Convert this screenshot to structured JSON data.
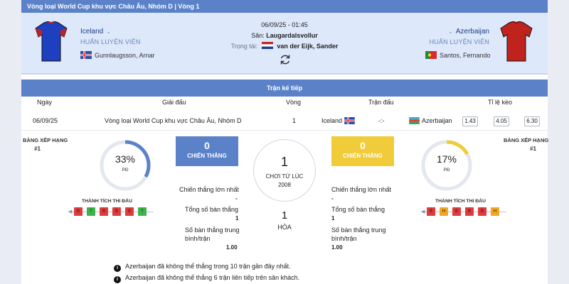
{
  "header": {
    "competition": "Vòng loại World Cup khu vực Châu Âu, Nhóm D | Vòng 1",
    "datetime": "06/09/25 - 01:45",
    "stadium_label": "Sân:",
    "stadium": "Laugardalsvollur",
    "referee_label": "Trọng tài:",
    "referee": "van der Eijk, Sander"
  },
  "home": {
    "name": "Iceland",
    "coach_label": "HUẤN LUYỆN VIÊN",
    "coach": "Gunnlaugsson, Arnar",
    "jersey_color": "#1e3fbf"
  },
  "away": {
    "name": "Azerbaijan",
    "coach_label": "HUẤN LUYỆN VIÊN",
    "coach": "Santos, Fernando",
    "jersey_color": "#c0221e"
  },
  "next_match": {
    "title": "Trận kế tiếp",
    "columns": [
      "Ngày",
      "Giải đấu",
      "Vòng",
      "Trận đấu",
      "Tỉ lệ kèo"
    ],
    "row": {
      "date": "06/09/25",
      "league": "Vòng loại World Cup khu vực Châu Âu, Nhóm D",
      "round": "1",
      "home": "Iceland",
      "score": "-:-",
      "away": "Azerbaijan",
      "odds": [
        "1.43",
        "4.05",
        "6.30"
      ]
    }
  },
  "stats": {
    "rank_label": "BẢNG XẾP HẠNG",
    "home_rank": "#1",
    "away_rank": "#1",
    "home_pct": "33%",
    "away_pct": "17%",
    "pct_sub": "PĐ",
    "home_pct_value": 0.33,
    "away_pct_value": 0.17,
    "home_wins": "0",
    "away_wins": "0",
    "wins_label": "CHIẾN THẮNG",
    "meetings": "1",
    "since_label": "CHƠI TỪ LÚC",
    "since_year": "2008",
    "draws": "1",
    "draws_label": "HÒA",
    "biggest_win_label": "Chiến thắng lớn nhất",
    "home_biggest_win": "-",
    "away_biggest_win": "-",
    "total_goals_label": "Tổng số bàn thắng",
    "home_total_goals": "1",
    "away_total_goals": "1",
    "avg_goals_label": "Số bàn thắng trung bình/trận",
    "home_avg_goals": "1.00",
    "away_avg_goals": "1.00",
    "form_label": "THÀNH TÍCH THI ĐẤU",
    "home_form": [
      "B",
      "T",
      "B",
      "B",
      "B",
      "T"
    ],
    "away_form": [
      "B",
      "H",
      "B",
      "B",
      "B",
      "H"
    ],
    "colors": {
      "win": "#3db44b",
      "loss": "#e03a3a",
      "draw": "#f3a622",
      "home_box": "#5b82c9",
      "away_box": "#f0cc3a"
    }
  },
  "notes": [
    "Azerbaijan đã không thể thắng trong 10 trận gần đây nhất.",
    "Azerbaijan đã không thể thắng 6 trận liên tiếp trên sân khách."
  ]
}
